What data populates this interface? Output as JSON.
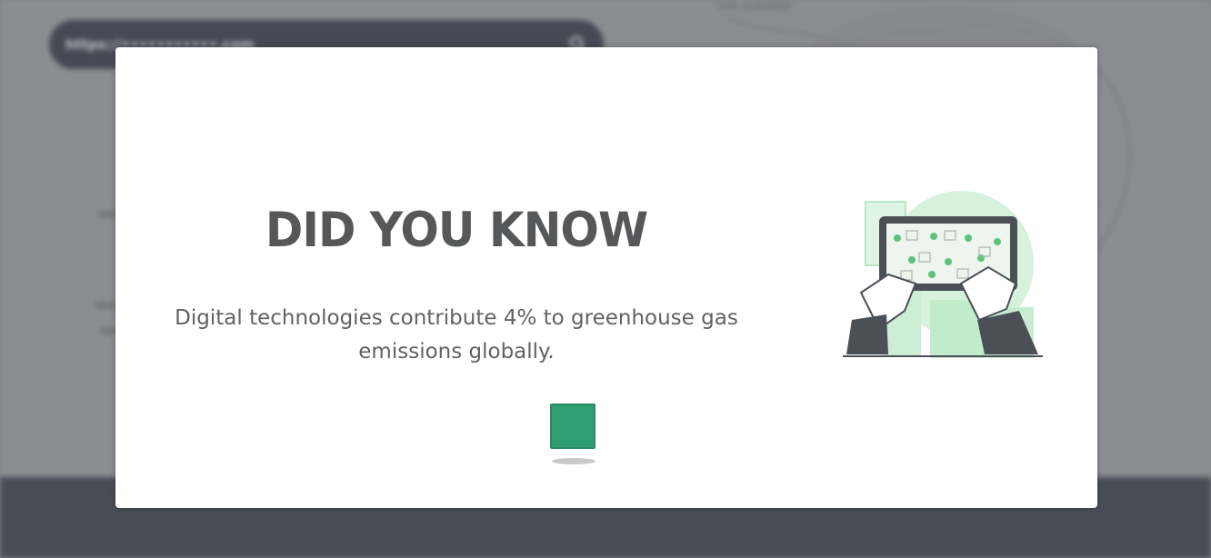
{
  "background": {
    "url_bar": {
      "text": "https://•••••••••••.com",
      "icon": "search-icon"
    },
    "map_caption": "info available"
  },
  "modal": {
    "title": "DID YOU KNOW",
    "text": "Digital technologies contribute 4% to greenhouse gas emissions globally.",
    "next_button": {
      "icon": "square-icon",
      "color": "#2f9e74"
    },
    "illustration": {
      "icon": "tablet-hands-illustration",
      "accent": "#a8e0b5"
    }
  },
  "colors": {
    "accent": "#2f9e74",
    "footer": "#494d57",
    "modal_bg": "#ffffff"
  }
}
